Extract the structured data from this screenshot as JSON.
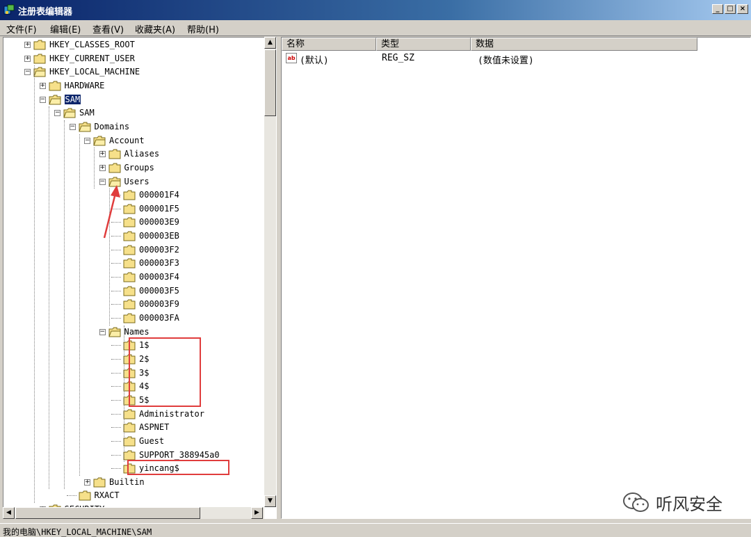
{
  "window": {
    "title": "注册表编辑器",
    "btn_min": "_",
    "btn_max": "□",
    "btn_close": "×"
  },
  "menu": [
    "文件(F)",
    "编辑(E)",
    "查看(V)",
    "收藏夹(A)",
    "帮助(H)"
  ],
  "tree": [
    {
      "label": "HKEY_CLASSES_ROOT",
      "exp": "+"
    },
    {
      "label": "HKEY_CURRENT_USER",
      "exp": "+"
    },
    {
      "label": "HKEY_LOCAL_MACHINE",
      "exp": "-"
    },
    {
      "label": "HARDWARE",
      "exp": "+"
    },
    {
      "label": "SAM",
      "exp": "-",
      "selected": true
    },
    {
      "label": "SAM",
      "exp": "-"
    },
    {
      "label": "Domains",
      "exp": "-"
    },
    {
      "label": "Account",
      "exp": "-"
    },
    {
      "label": "Aliases",
      "exp": "+"
    },
    {
      "label": "Groups",
      "exp": "+"
    },
    {
      "label": "Users",
      "exp": "-"
    },
    {
      "label": "000001F4"
    },
    {
      "label": "000001F5"
    },
    {
      "label": "000003E9"
    },
    {
      "label": "000003EB"
    },
    {
      "label": "000003F2"
    },
    {
      "label": "000003F3"
    },
    {
      "label": "000003F4"
    },
    {
      "label": "000003F5"
    },
    {
      "label": "000003F9"
    },
    {
      "label": "000003FA"
    },
    {
      "label": "Names",
      "exp": "-"
    },
    {
      "label": "1$"
    },
    {
      "label": "2$"
    },
    {
      "label": "3$"
    },
    {
      "label": "4$"
    },
    {
      "label": "5$"
    },
    {
      "label": "Administrator"
    },
    {
      "label": "ASPNET"
    },
    {
      "label": "Guest"
    },
    {
      "label": "SUPPORT_388945a0"
    },
    {
      "label": "yincang$"
    },
    {
      "label": "Builtin",
      "exp": "+"
    },
    {
      "label": "RXACT"
    },
    {
      "label": "SECURITY",
      "exp": "+"
    }
  ],
  "list": {
    "columns": [
      "名称",
      "类型",
      "数据"
    ],
    "rows": [
      {
        "icon": "ab",
        "name": "(默认)",
        "type": "REG_SZ",
        "data": "(数值未设置)"
      }
    ]
  },
  "status": "我的电脑\\HKEY_LOCAL_MACHINE\\SAM",
  "scroll": {
    "up": "▲",
    "down": "▼",
    "left": "◀",
    "right": "▶"
  },
  "watermark": "听风安全",
  "colors": {
    "titlebar": "#0a246a",
    "selection": "#0a246a",
    "highlight": "#e03c3c",
    "annotation_arrow": "#e03c3c",
    "folder": "#f6e08a"
  }
}
